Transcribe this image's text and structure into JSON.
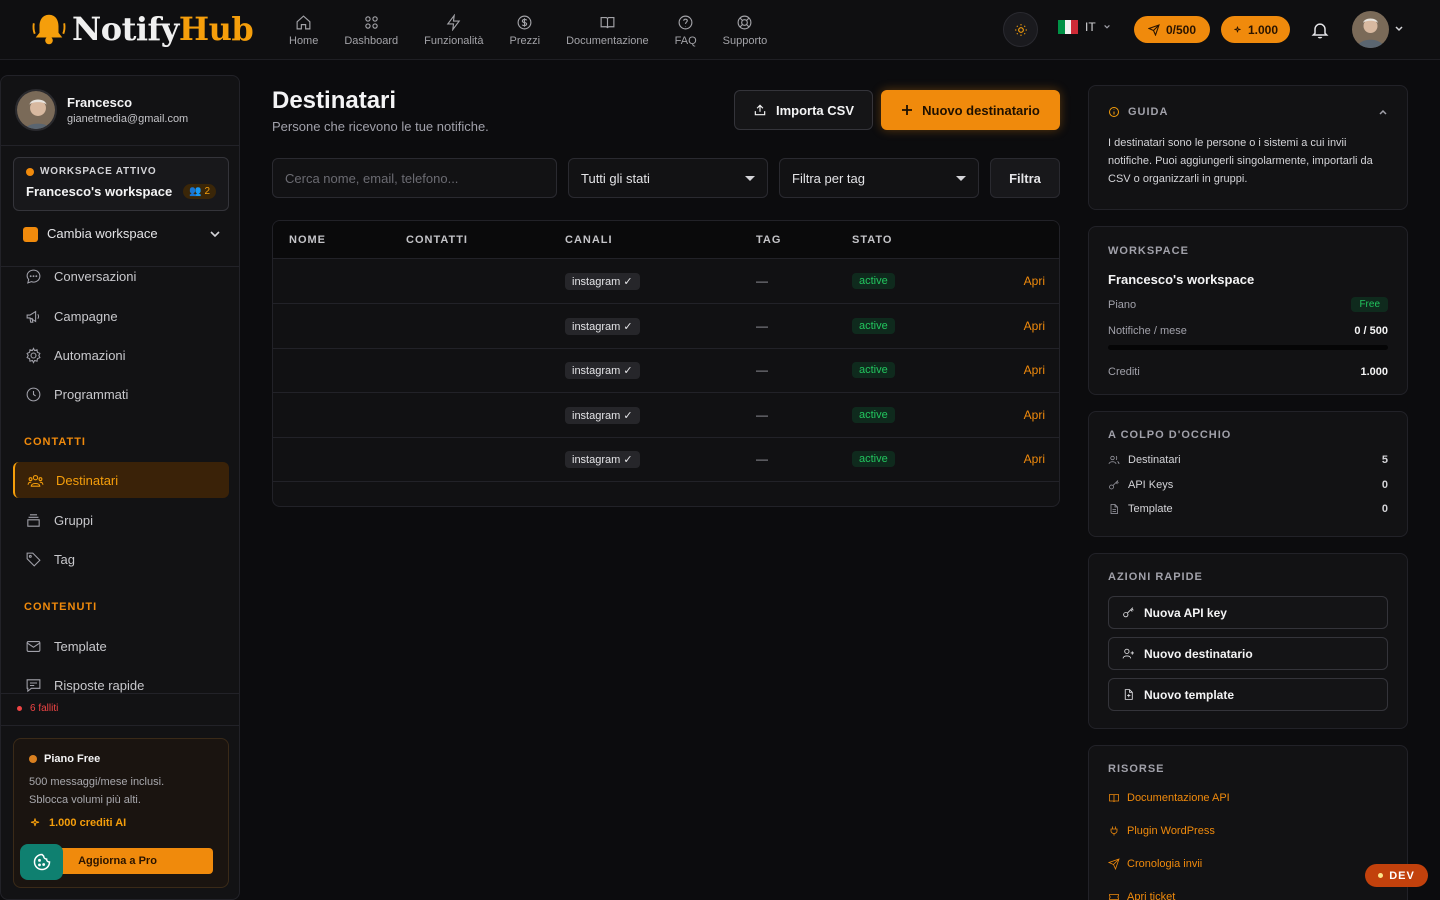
{
  "brand": {
    "name_part1": "Notify",
    "name_part2": "Hub"
  },
  "nav": [
    {
      "label": "Home",
      "icon": "home-icon"
    },
    {
      "label": "Dashboard",
      "icon": "grid-icon"
    },
    {
      "label": "Funzionalità",
      "icon": "bolt-icon"
    },
    {
      "label": "Prezzi",
      "icon": "dollar-icon"
    },
    {
      "label": "Documentazione",
      "icon": "book-icon"
    },
    {
      "label": "FAQ",
      "icon": "help-icon"
    },
    {
      "label": "Supporto",
      "icon": "lifebuoy-icon"
    }
  ],
  "topbar": {
    "language": "IT",
    "messages_pill": "0/500",
    "credits_pill": "1.000",
    "accent": "#f08a0c"
  },
  "user": {
    "name": "Francesco",
    "email": "gianetmedia@gmail.com"
  },
  "workspace": {
    "label": "WORKSPACE ATTIVO",
    "name": "Francesco's workspace",
    "members": "2",
    "switch_label": "Cambia workspace"
  },
  "sidebar": {
    "items_top": [
      {
        "label": "Conversazioni",
        "icon": "chat-icon"
      },
      {
        "label": "Campagne",
        "icon": "megaphone-icon"
      },
      {
        "label": "Automazioni",
        "icon": "gear-icon"
      },
      {
        "label": "Programmati",
        "icon": "clock-icon"
      }
    ],
    "section_contacts": "CONTATTI",
    "items_contacts": [
      {
        "label": "Destinatari",
        "icon": "users-icon",
        "active": true
      },
      {
        "label": "Gruppi",
        "icon": "layers-icon"
      },
      {
        "label": "Tag",
        "icon": "tag-icon"
      }
    ],
    "section_content": "CONTENUTI",
    "items_content": [
      {
        "label": "Template",
        "icon": "mail-icon"
      },
      {
        "label": "Risposte rapide",
        "icon": "message-icon"
      }
    ],
    "failed": "6 falliti"
  },
  "plan": {
    "title": "Piano Free",
    "desc_line1": "500 messaggi/mese inclusi.",
    "desc_line2": "Sblocca volumi più alti.",
    "credits": "1.000 crediti AI",
    "upgrade": "Aggiorna a Pro"
  },
  "main": {
    "title": "Destinatari",
    "subtitle": "Persone che ricevono le tue notifiche.",
    "import_btn": "Importa CSV",
    "new_btn": "Nuovo destinatario",
    "search_placeholder": "Cerca nome, email, telefono...",
    "status_select": "Tutti gli stati",
    "tag_select": "Filtra per tag",
    "filter_btn": "Filtra"
  },
  "table": {
    "headers": {
      "name": "NOME",
      "contacts": "CONTATTI",
      "channels": "CANALI",
      "tag": "TAG",
      "status": "STATO"
    },
    "rows": [
      {
        "channel": "instagram ✓",
        "tag": "—",
        "status": "active",
        "action": "Apri"
      },
      {
        "channel": "instagram ✓",
        "tag": "—",
        "status": "active",
        "action": "Apri"
      },
      {
        "channel": "instagram ✓",
        "tag": "—",
        "status": "active",
        "action": "Apri"
      },
      {
        "channel": "instagram ✓",
        "tag": "—",
        "status": "active",
        "action": "Apri"
      },
      {
        "channel": "instagram ✓",
        "tag": "—",
        "status": "active",
        "action": "Apri"
      }
    ]
  },
  "guide": {
    "title": "GUIDA",
    "text": "I destinatari sono le persone o i sistemi a cui invii notifiche. Puoi aggiungerli singolarmente, importarli da CSV o organizzarli in gruppi."
  },
  "ws_card": {
    "title": "WORKSPACE",
    "name": "Francesco's workspace",
    "plan_label": "Piano",
    "plan_value": "Free",
    "notif_label": "Notifiche / mese",
    "notif_value": "0 / 500",
    "notif_fraction": 0,
    "credits_label": "Crediti",
    "credits_value": "1.000"
  },
  "glance": {
    "title": "A COLPO D'OCCHIO",
    "rows": [
      {
        "label": "Destinatari",
        "value": "5",
        "icon": "users-icon"
      },
      {
        "label": "API Keys",
        "value": "0",
        "icon": "key-icon"
      },
      {
        "label": "Template",
        "value": "0",
        "icon": "file-icon"
      }
    ]
  },
  "quick": {
    "title": "AZIONI RAPIDE",
    "buttons": [
      {
        "label": "Nuova API key",
        "icon": "key-icon"
      },
      {
        "label": "Nuovo destinatario",
        "icon": "user-plus-icon"
      },
      {
        "label": "Nuovo template",
        "icon": "file-plus-icon"
      }
    ]
  },
  "resources": {
    "title": "RISORSE",
    "links": [
      {
        "label": "Documentazione API",
        "icon": "book-icon"
      },
      {
        "label": "Plugin WordPress",
        "icon": "plugin-icon"
      },
      {
        "label": "Cronologia invii",
        "icon": "send-icon"
      },
      {
        "label": "Apri ticket",
        "icon": "ticket-icon"
      }
    ]
  },
  "dev_badge": "DEV"
}
